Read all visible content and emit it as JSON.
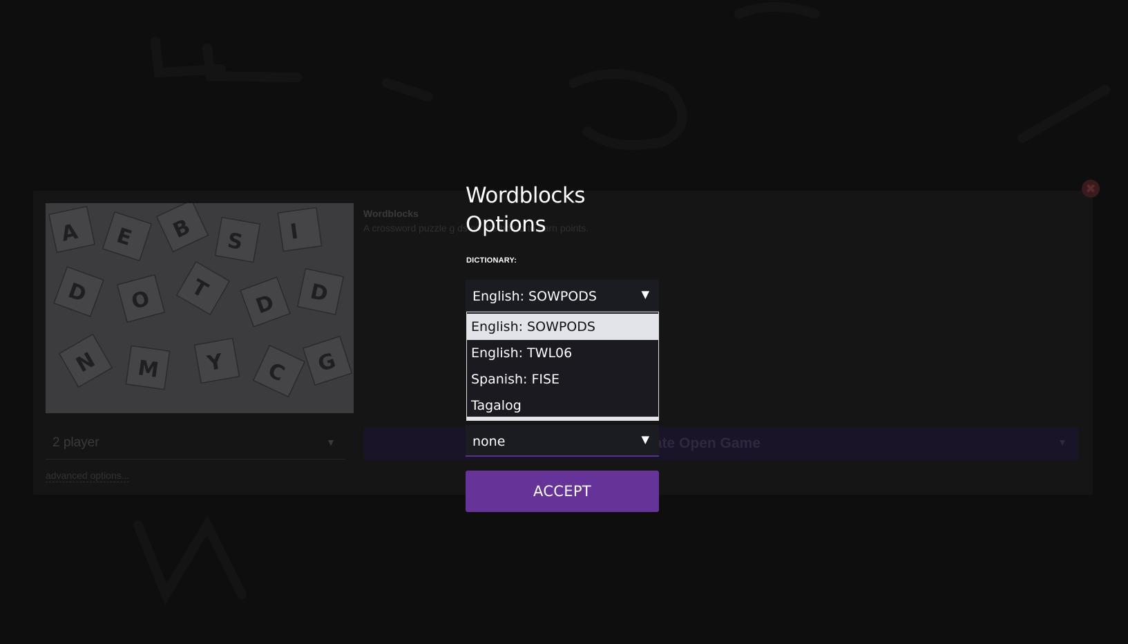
{
  "modal": {
    "title_line1": "Wordblocks",
    "title_line2": "Options",
    "dictionary_label": "DICTIONARY:",
    "dictionary_selected": "English: SOWPODS",
    "dictionary_options": [
      {
        "label": "English: SOWPODS",
        "selected": true
      },
      {
        "label": "English: TWL06",
        "selected": false
      },
      {
        "label": "Spanish: FISE",
        "selected": false
      },
      {
        "label": "Tagalog",
        "selected": false
      }
    ],
    "second_select_value": "none",
    "caret": "▼",
    "accept_label": "ACCEPT"
  },
  "background": {
    "game_title": "Wordblocks",
    "game_description": "A crossword puzzle g          ds on the board to earn points.",
    "players_value": "2 player",
    "create_label": "reate Open Game",
    "advanced_options": "advanced options...",
    "close_glyph": "✖"
  },
  "colors": {
    "accent": "#663399",
    "modal_text": "#ffffff",
    "select_bg": "#1b1b22",
    "option_highlight": "#e3e3ea"
  },
  "icons": {
    "dropdown_caret": "caret-down-icon",
    "close": "close-icon"
  }
}
